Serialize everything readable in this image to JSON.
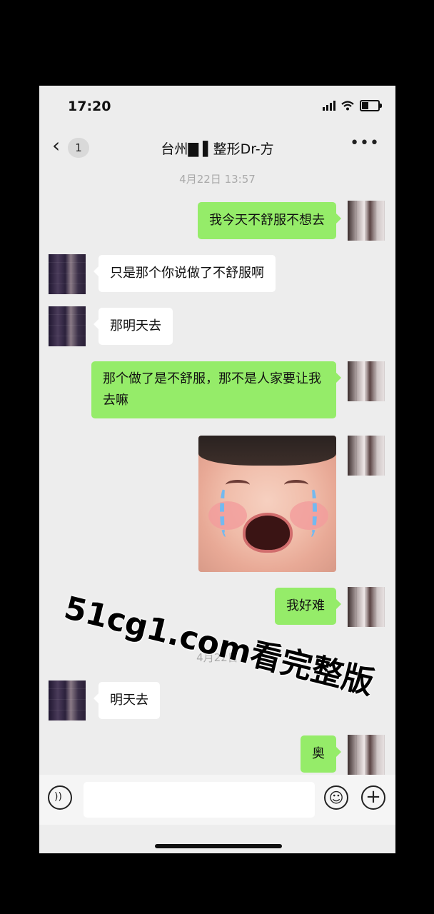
{
  "status_bar": {
    "time": "17:20"
  },
  "nav": {
    "back_glyph": "‹",
    "unread_count": "1",
    "title": "台州▇ ▌整形Dr-方",
    "more_glyph": "•••"
  },
  "timestamps": [
    "4月22日 13:57",
    "4月22日"
  ],
  "messages": [
    {
      "side": "right",
      "text": "我今天不舒服不想去"
    },
    {
      "side": "left",
      "text": "只是那个你说做了不舒服啊"
    },
    {
      "side": "left",
      "text": "那明天去"
    },
    {
      "side": "right",
      "text": "那个做了是不舒服，那不是人家要让我去嘛"
    },
    {
      "side": "right",
      "type": "sticker",
      "sticker": "crying-baby"
    },
    {
      "side": "right",
      "text": "我好难"
    },
    {
      "side": "left",
      "text": "明天去"
    },
    {
      "side": "right",
      "text": "奥"
    }
  ],
  "watermark": "51cg1.com看完整版",
  "input_bar": {
    "emoji_glyph": "☺",
    "plus_glyph": "+"
  },
  "colors": {
    "my_bubble": "#95ec69",
    "their_bubble": "#ffffff",
    "chat_bg": "#ededed"
  }
}
